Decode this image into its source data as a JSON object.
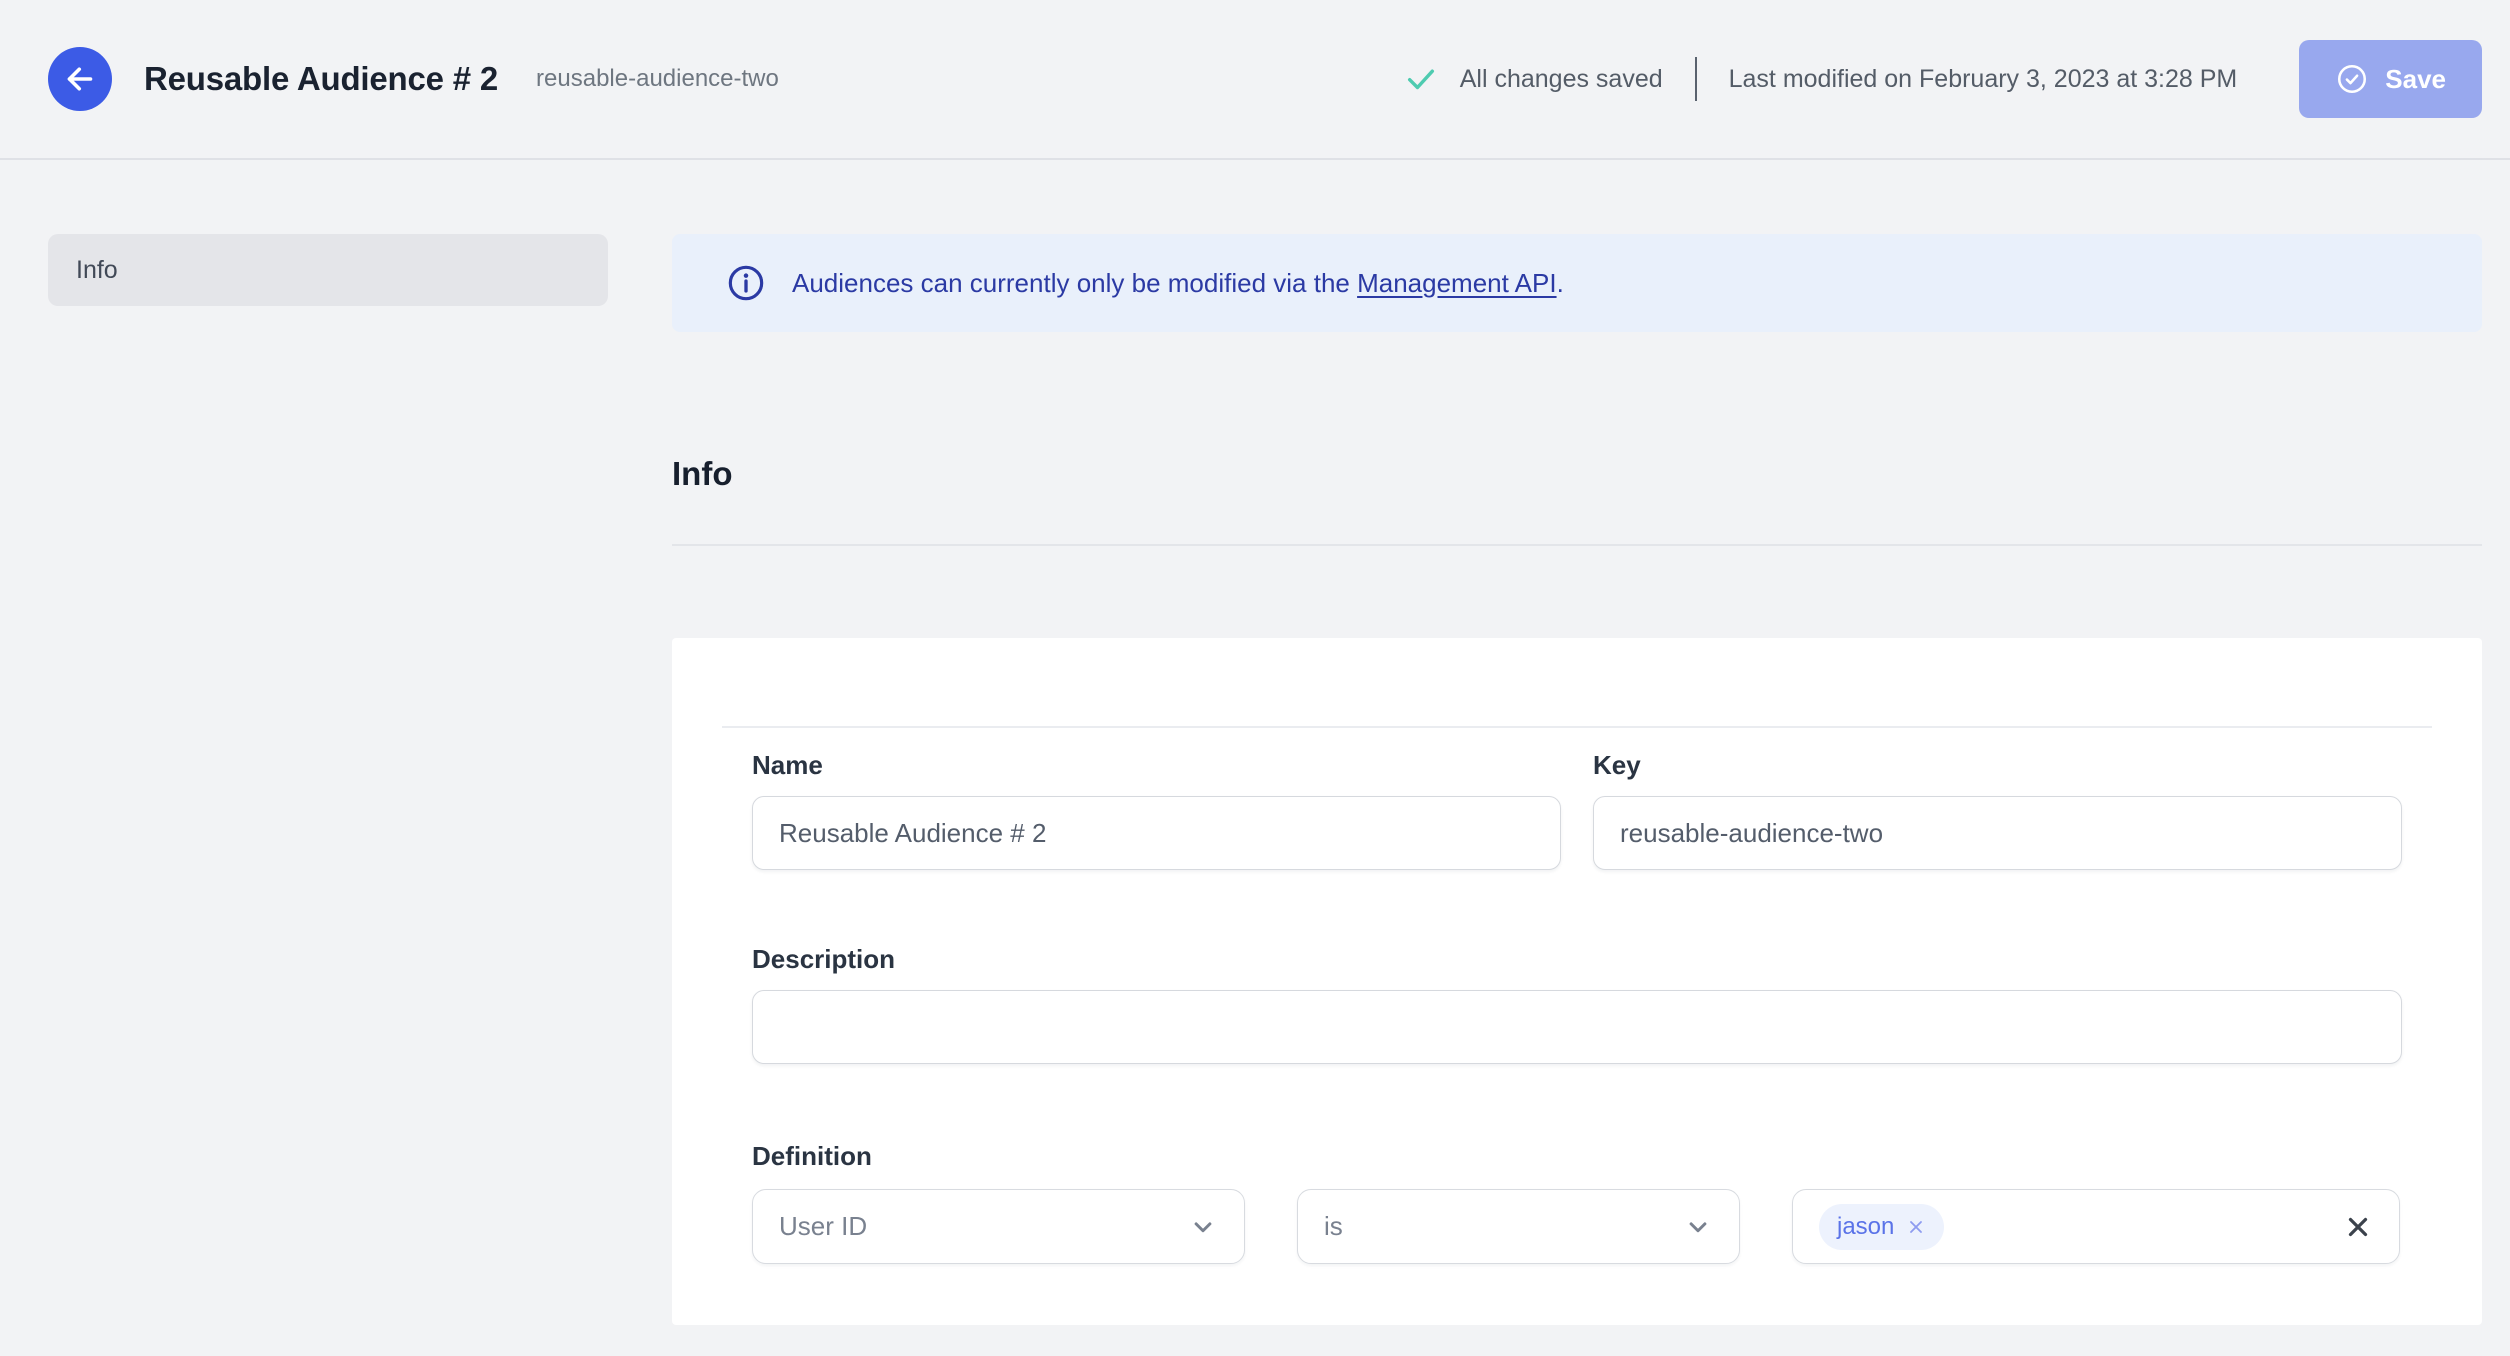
{
  "header": {
    "title": "Reusable Audience # 2",
    "subtitle": "reusable-audience-two",
    "status": "All changes saved",
    "last_modified": "Last modified on February 3, 2023 at 3:28 PM",
    "save_label": "Save"
  },
  "sidebar": {
    "items": [
      {
        "label": "Info"
      }
    ]
  },
  "banner": {
    "text_before_link": "Audiences can currently only be modified via the ",
    "link_text": "Management API",
    "text_after_link": "."
  },
  "section": {
    "heading": "Info"
  },
  "form": {
    "name": {
      "label": "Name",
      "value": "Reusable Audience # 2"
    },
    "key": {
      "label": "Key",
      "value": "reusable-audience-two"
    },
    "description": {
      "label": "Description",
      "value": ""
    },
    "definition": {
      "label": "Definition",
      "attribute": "User ID",
      "operator": "is",
      "values": [
        "jason"
      ]
    }
  },
  "colors": {
    "accent_blue": "#3c5be6",
    "save_button": "#98a8ee",
    "banner_bg": "#e9f0fb",
    "banner_text": "#2b3aa4",
    "success_green": "#4ecbb0",
    "chip_bg": "#edf2fd",
    "chip_text": "#5a73e8",
    "page_bg": "#f2f3f5"
  }
}
